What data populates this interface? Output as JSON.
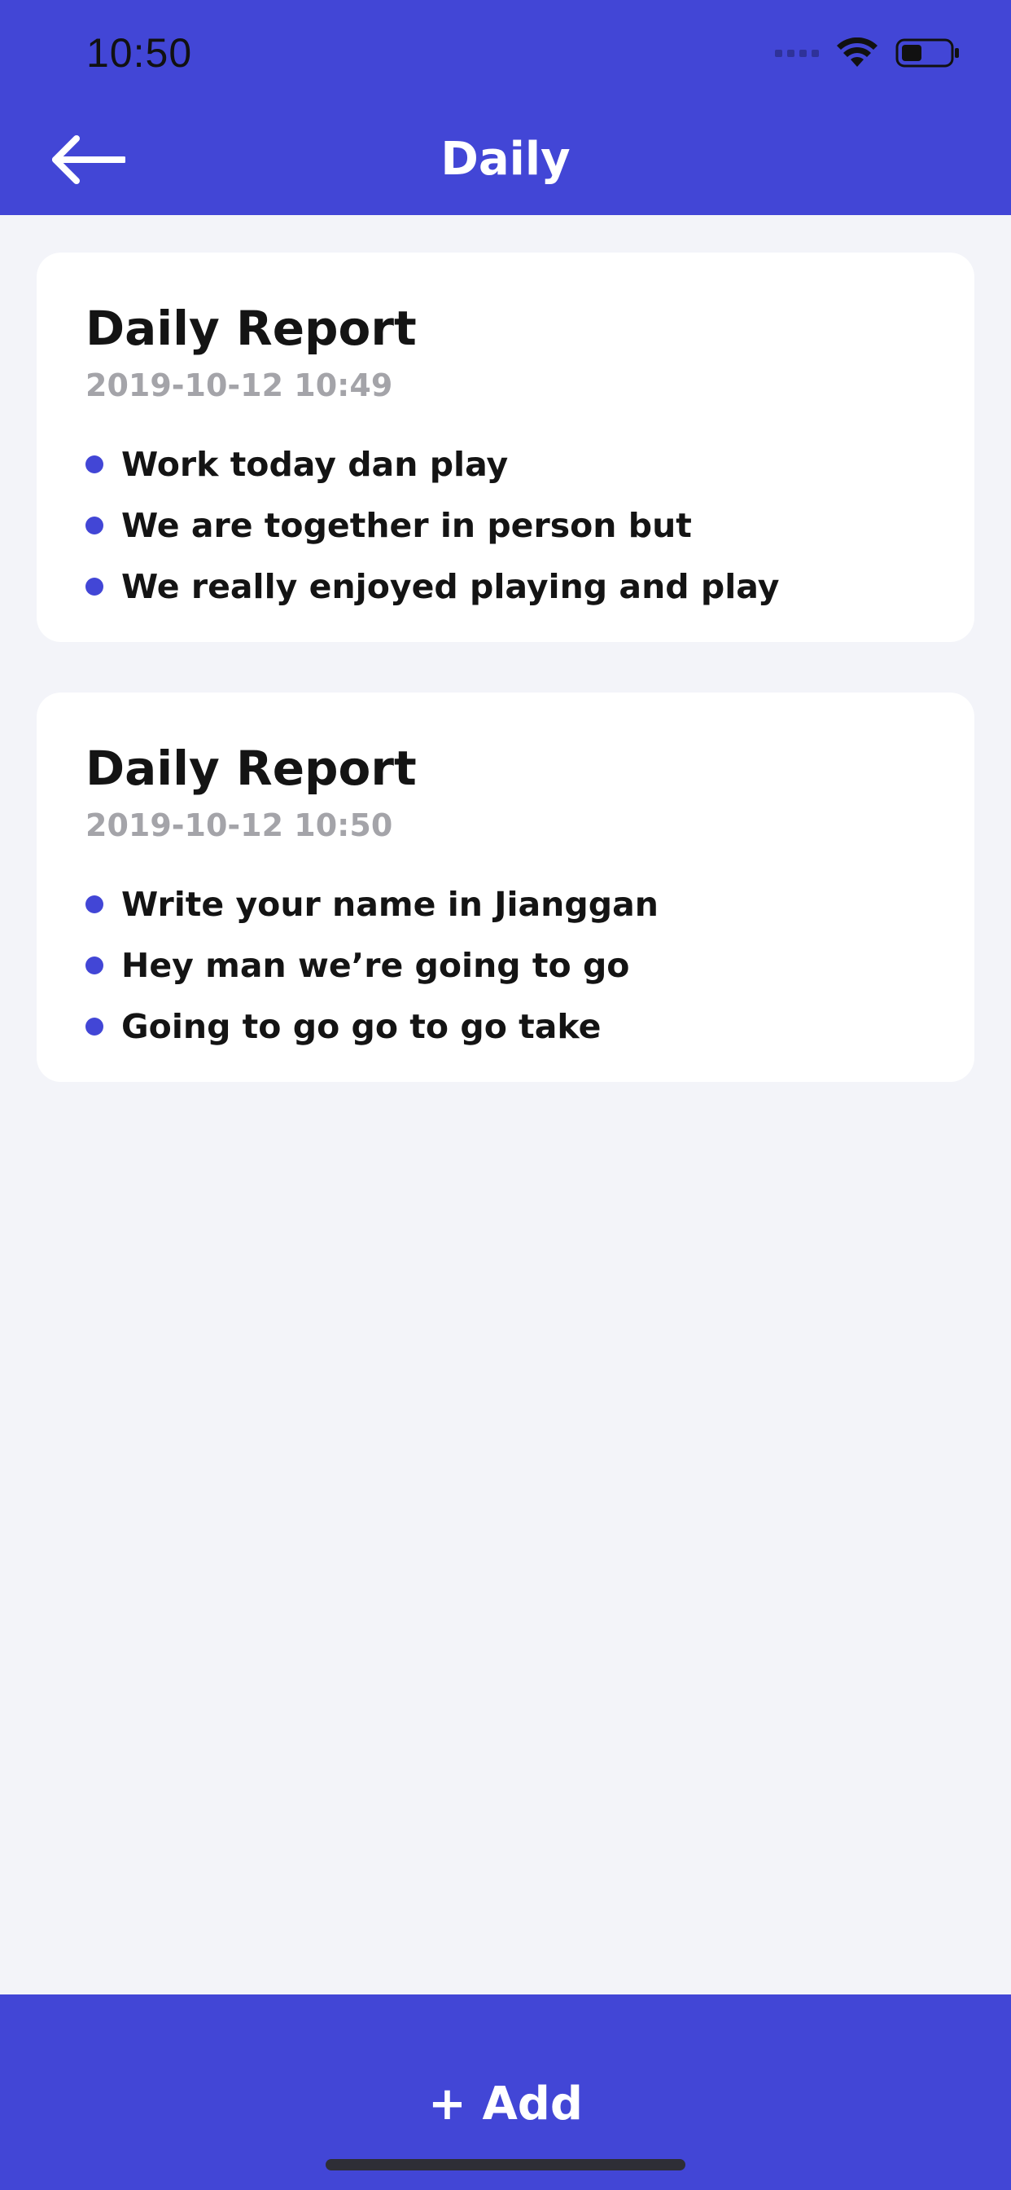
{
  "status_bar": {
    "time": "10:50"
  },
  "header": {
    "title": "Daily"
  },
  "reports": [
    {
      "title": "Daily Report",
      "date": "2019-10-12 10:49",
      "items": [
        "Work today dan play",
        "We are together in person but",
        "We really enjoyed playing and play"
      ]
    },
    {
      "title": "Daily Report",
      "date": "2019-10-12 10:50",
      "items": [
        "Write your name in Jianggan",
        "Hey man we’re going to go",
        "Going to go go to go take"
      ]
    }
  ],
  "footer": {
    "add_label": "+ Add"
  },
  "icons": {
    "back": "arrow-left-icon",
    "wifi": "wifi-icon",
    "battery": "battery-icon",
    "signal": "signal-icon"
  },
  "colors": {
    "accent": "#4246D6",
    "background": "#F3F4F9",
    "card": "#FFFFFF",
    "text": "#141414",
    "muted": "#A4A4A9"
  }
}
